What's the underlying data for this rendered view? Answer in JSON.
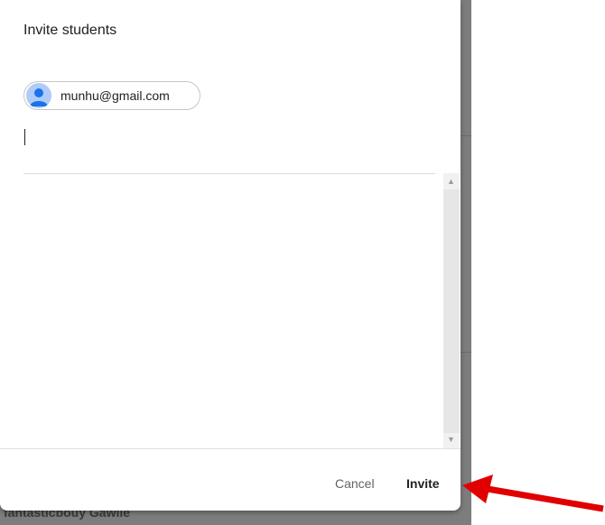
{
  "background": {
    "partial_text": "fantasticbouy Gawile"
  },
  "dialog": {
    "title": "Invite students",
    "chips": [
      {
        "label": "munhu@gmail.com",
        "icon": "person-avatar-icon"
      }
    ],
    "input": {
      "value": ""
    },
    "footer": {
      "cancel_label": "Cancel",
      "invite_label": "Invite"
    }
  },
  "annotation": {
    "icon": "red-arrow-icon",
    "color": "#e00000"
  }
}
